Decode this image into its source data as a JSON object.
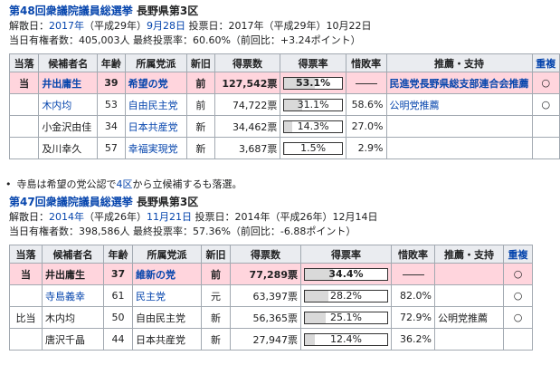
{
  "sec1": {
    "title_link": "第48回衆議院議員総選挙",
    "title_rest": " 長野県第3区",
    "line1": {
      "l1": "解散日：",
      "l2": "2017年",
      "l3": "（平成29年）",
      "l4": "9月28日",
      "l5": " 投票日：2017年（平成29年）10月22日"
    },
    "line2": "当日有権者数：405,003人 最終投票率：60.60%（前回比：+3.24ポイント）",
    "headers": [
      "当落",
      "候補者名",
      "年齢",
      "所属党派",
      "新旧",
      "得票数",
      "得票率",
      "惜敗率",
      "推薦・支持",
      "重複"
    ],
    "rows": [
      {
        "result": "当",
        "name": "井出庸生",
        "age": "39",
        "party": "希望の党",
        "status": "前",
        "votes": "127,542票",
        "rate": "53.1%",
        "ratio": "",
        "support": "民進党長野県総支部連合会推薦",
        "dup": "○",
        "fill": 53.1,
        "win": true
      },
      {
        "result": "",
        "name": "木内均",
        "age": "53",
        "party": "自由民主党",
        "status": "前",
        "votes": "74,722票",
        "rate": "31.1%",
        "ratio": "58.6%",
        "support": "公明党推薦",
        "dup": "○",
        "fill": 31.1,
        "win": false
      },
      {
        "result": "",
        "name": "小金沢由佳",
        "age": "34",
        "party": "日本共産党",
        "status": "新",
        "votes": "34,462票",
        "rate": "14.3%",
        "ratio": "27.0%",
        "support": "",
        "dup": "",
        "fill": 14.3,
        "win": false
      },
      {
        "result": "",
        "name": "及川幸久",
        "age": "57",
        "party": "幸福実現党",
        "status": "新",
        "votes": "3,687票",
        "rate": "1.5%",
        "ratio": "2.9%",
        "support": "",
        "dup": "",
        "fill": 1.5,
        "win": false
      }
    ]
  },
  "note": {
    "t1": "寺島は希望の党公認で",
    "t2": "4区",
    "t3": "から立候補するも落選。"
  },
  "sec2": {
    "title_link": "第47回衆議院議員総選挙",
    "title_rest": " 長野県第3区",
    "line1": {
      "l1": "解散日：",
      "l2": "2014年",
      "l3": "（平成26年）",
      "l4": "11月21日",
      "l5": " 投票日：2014年（平成26年）12月14日"
    },
    "line2": "当日有権者数：398,586人 最終投票率：57.36%（前回比：-6.88ポイント）",
    "headers": [
      "当落",
      "候補者名",
      "年齢",
      "所属党派",
      "新旧",
      "得票数",
      "得票率",
      "惜敗率",
      "推薦・支持",
      "重複"
    ],
    "rows": [
      {
        "result": "当",
        "name": "井出庸生",
        "age": "37",
        "party": "維新の党",
        "status": "前",
        "votes": "77,289票",
        "rate": "34.4%",
        "ratio": "",
        "support": "",
        "dup": "○",
        "fill": 34.4,
        "win": true
      },
      {
        "result": "",
        "name": "寺島義幸",
        "age": "61",
        "party": "民主党",
        "status": "元",
        "votes": "63,397票",
        "rate": "28.2%",
        "ratio": "82.0%",
        "support": "",
        "dup": "○",
        "fill": 28.2,
        "win": false
      },
      {
        "result": "比当",
        "name": "木内均",
        "age": "50",
        "party": "自由民主党",
        "status": "新",
        "votes": "56,365票",
        "rate": "25.1%",
        "ratio": "72.9%",
        "support": "公明党推薦",
        "dup": "○",
        "fill": 25.1,
        "win": false
      },
      {
        "result": "",
        "name": "唐沢千晶",
        "age": "44",
        "party": "日本共産党",
        "status": "新",
        "votes": "27,947票",
        "rate": "12.4%",
        "ratio": "36.2%",
        "support": "",
        "dup": "",
        "fill": 12.4,
        "win": false
      }
    ]
  }
}
